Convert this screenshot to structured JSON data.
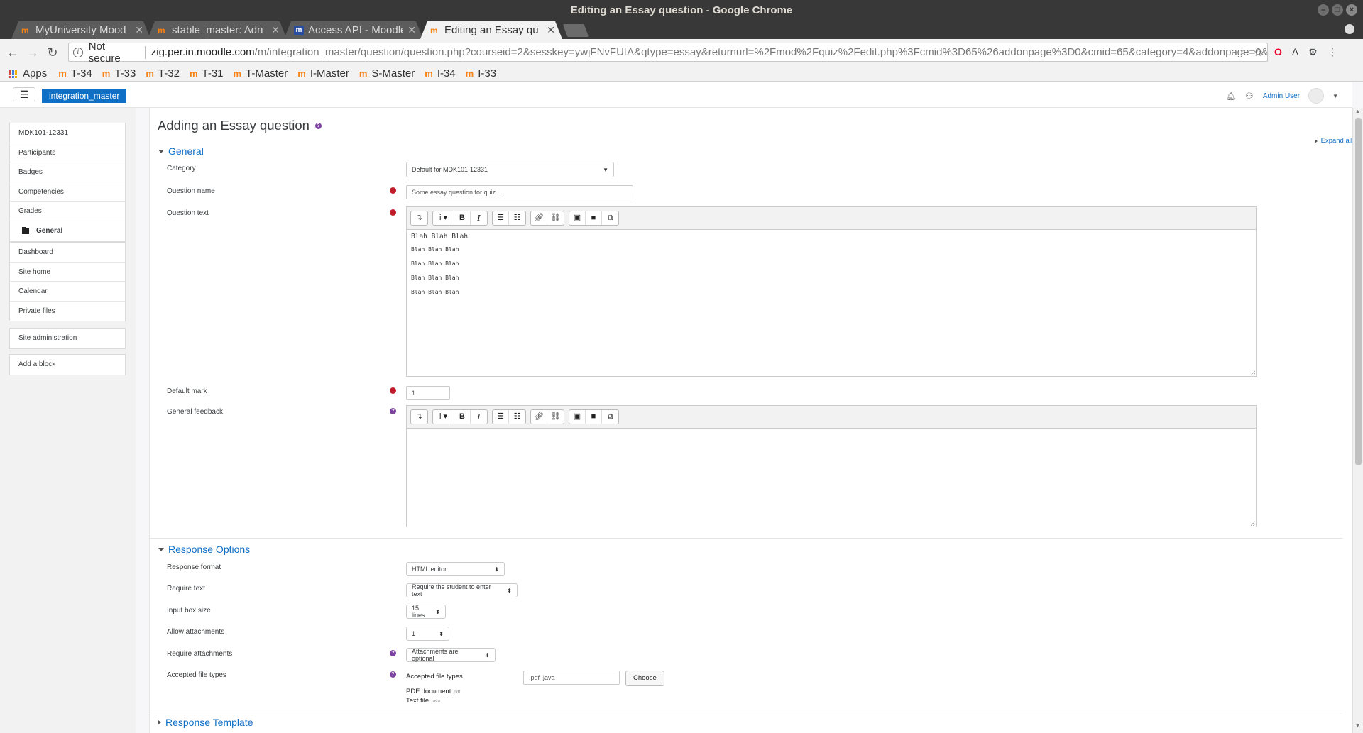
{
  "window": {
    "title": "Editing an Essay question - Google Chrome"
  },
  "tabs": [
    {
      "label": "MyUniversity Mood",
      "favicon": "moodle-icon",
      "active": false
    },
    {
      "label": "stable_master: Adn",
      "favicon": "moodle-icon",
      "active": false
    },
    {
      "label": "Access API - Moodle",
      "favicon": "moodle-docs-icon",
      "active": false
    },
    {
      "label": "Editing an Essay qu",
      "favicon": "moodle-icon",
      "active": true
    }
  ],
  "address_bar": {
    "security": "Not secure",
    "host": "zig.per.in.moodle.com",
    "path": "/m/integration_master/question/question.php?courseid=2&sesskey=ywjFNvFUtA&qtype=essay&returnurl=%2Fmod%2Fquiz%2Fedit.php%3Fcmid%3D65%26addonpage%3D0&cmid=65&category=4&addonpage=0&ap..."
  },
  "bookmarks": {
    "apps_label": "Apps",
    "items": [
      "T-34",
      "T-33",
      "T-32",
      "T-31",
      "T-Master",
      "I-Master",
      "S-Master",
      "I-34",
      "I-33"
    ]
  },
  "navbar": {
    "site_name": "integration_master",
    "user_name": "Admin User"
  },
  "sidebar": {
    "course_block": [
      "MDK101-12331",
      "Participants",
      "Badges",
      "Competencies",
      "Grades"
    ],
    "active_item": "General",
    "site_block": [
      "Dashboard",
      "Site home",
      "Calendar",
      "Private files"
    ],
    "admin_item": "Site administration",
    "add_block": "Add a block"
  },
  "form": {
    "heading": "Adding an Essay question",
    "expand_all": "Expand all",
    "general": {
      "title": "General",
      "category_label": "Category",
      "category_value": "Default for MDK101-12331",
      "question_name_label": "Question name",
      "question_name_value": "Some essay question for quiz...",
      "question_text_label": "Question text",
      "question_text_lines": [
        "Blah Blah Blah",
        "Blah Blah Blah",
        "Blah Blah Blah",
        "Blah Blah Blah",
        "Blah Blah Blah"
      ],
      "default_mark_label": "Default mark",
      "default_mark_value": "1",
      "general_feedback_label": "General feedback"
    },
    "response_options": {
      "title": "Response Options",
      "response_format_label": "Response format",
      "response_format_value": "HTML editor",
      "require_text_label": "Require text",
      "require_text_value": "Require the student to enter text",
      "input_box_size_label": "Input box size",
      "input_box_size_value": "15 lines",
      "allow_attachments_label": "Allow attachments",
      "allow_attachments_value": "1",
      "require_attachments_label": "Require attachments",
      "require_attachments_value": "Attachments are optional",
      "accepted_file_types_label": "Accepted file types",
      "accepted_file_types_inline_label": "Accepted file types",
      "accepted_file_types_value": ".pdf .java",
      "choose_button": "Choose",
      "file_types": [
        {
          "name": "PDF document",
          "ext": ".pdf"
        },
        {
          "name": "Text file",
          "ext": ".java"
        }
      ]
    },
    "response_template": {
      "title": "Response Template"
    }
  }
}
